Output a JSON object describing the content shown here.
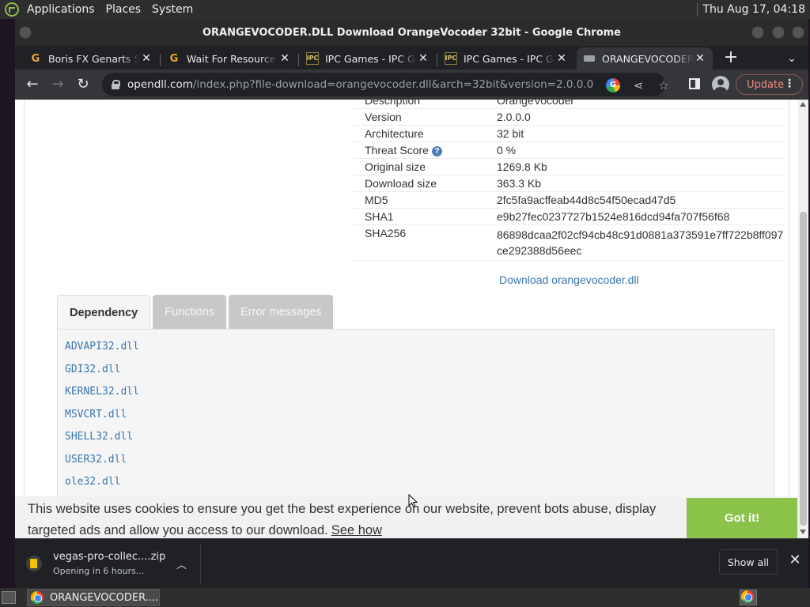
{
  "desktop": {
    "menus": [
      "Applications",
      "Places",
      "System"
    ],
    "clock": "Thu Aug 17, 04:18"
  },
  "window": {
    "title": "ORANGEVOCODER.DLL Download OrangeVocoder 32bit - Google Chrome"
  },
  "tabs": [
    {
      "label": "Boris FX Genarts Sapphire",
      "favicon": "G"
    },
    {
      "label": "Wait For Resource",
      "favicon": "G"
    },
    {
      "label": "IPC Games - IPC Games",
      "favicon": "IPC"
    },
    {
      "label": "IPC Games - IPC Games",
      "favicon": "IPC"
    },
    {
      "label": "ORANGEVOCODER.DLL",
      "favicon": "dll"
    }
  ],
  "toolbar": {
    "url_host": "opendll.com",
    "url_path": "/index.php?file-download=orangevocoder.dll&arch=32bit&version=2.0.0.0",
    "update_label": "Update"
  },
  "details": {
    "rows": [
      {
        "key": "Description",
        "value": "OrangeVocoder"
      },
      {
        "key": "Version",
        "value": "2.0.0.0"
      },
      {
        "key": "Architecture",
        "value": "32 bit"
      },
      {
        "key": "Threat Score",
        "value": "0 %"
      },
      {
        "key": "Original size",
        "value": "1269.8 Kb"
      },
      {
        "key": "Download size",
        "value": "363.3 Kb"
      },
      {
        "key": "MD5",
        "value": "2fc5fa9acffeab44d8c54f50ecad47d5"
      },
      {
        "key": "SHA1",
        "value": "e9b27fec0237727b1524e816dcd94fa707f56f68"
      },
      {
        "key": "SHA256",
        "value": "86898dcaa2f02cf94cb48c91d0881a373591e7ff722b8ff097ce292388d56eec"
      }
    ],
    "download_link": "Download orangevocoder.dll"
  },
  "page_tabs": [
    {
      "label": "Dependency",
      "active": true
    },
    {
      "label": "Functions",
      "active": false
    },
    {
      "label": "Error messages",
      "active": false
    }
  ],
  "dependencies": [
    "ADVAPI32.dll",
    "GDI32.dll",
    "KERNEL32.dll",
    "MSVCRT.dll",
    "SHELL32.dll",
    "USER32.dll",
    "ole32.dll"
  ],
  "cookie": {
    "text": "This website uses cookies to ensure you get the best experience on our website, prevent bots abuse, display targeted ads and allow you access to our download.",
    "link": "See how",
    "button": "Got it!"
  },
  "shelf": {
    "file_name": "vegas-pro-collec....zip",
    "status": "Opening in 6 hours...",
    "show_all": "Show all"
  },
  "taskbar": {
    "item_label": "ORANGEVOCODER...."
  },
  "colors": {
    "accent_link": "#3a75ad",
    "gotit_green": "#8bc34a",
    "update_red": "#f28b82"
  }
}
